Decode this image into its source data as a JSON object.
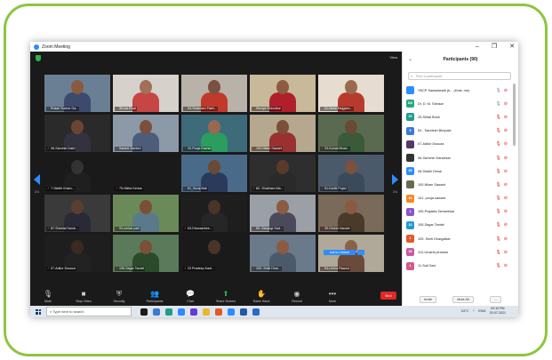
{
  "window": {
    "title": "Zoom Meeting",
    "minimize": "–",
    "maximize": "❐",
    "close": "✕"
  },
  "meeting": {
    "view_label": "View",
    "page_left": "2/4",
    "page_right": "2/4",
    "join_button": "Ask to Unmute",
    "tiles": [
      {
        "name": "Rukari Tushar Ga...",
        "bg": "#6b7f94",
        "skin": "#8a5a3c",
        "shirt": "#3c4a6e"
      },
      {
        "name": "35-Isa Pisal",
        "bg": "#d6d1cb",
        "skin": "#a0705a",
        "shirt": "#c64545"
      },
      {
        "name": "34-Shabnam Patel...",
        "bg": "#b8b2a8",
        "skin": "#7a5040",
        "shirt": "#c0392b"
      },
      {
        "name": "Shreya Shirodkar",
        "bg": "#c8b99a",
        "skin": "#8d5a42",
        "shirt": "#b0202a"
      },
      {
        "name": "31-Neha Majgaon...",
        "bg": "#e6ddd0",
        "skin": "#9a6a4e",
        "shirt": "#b83a2f"
      },
      {
        "name": "06-Sarvesh Dalvi",
        "bg": "#2a2a2a",
        "skin": "#6a4432",
        "shirt": "#33333f"
      },
      {
        "name": "Sanket Zambre",
        "bg": "#8c9aa8",
        "skin": "#7b503a",
        "shirt": "#4c5d7a"
      },
      {
        "name": "20-Pooja Kashid",
        "bg": "#3d6b7a",
        "skin": "#9a6850",
        "shirt": "#2a9d5f"
      },
      {
        "name": "100-Nilam Sawant",
        "bg": "#b5a88f",
        "skin": "#7a5038",
        "shirt": "#9a3030"
      },
      {
        "name": "33-Komal Mhad...",
        "bg": "#5a6a50",
        "skin": "#6a4a34",
        "shirt": "#3a5a3a"
      },
      {
        "name": "7-Siddhi Kham...",
        "bg": "#1a1a1a",
        "skin": "#333333",
        "shirt": "#1f1f1f"
      },
      {
        "name": "75-Nikita Kerkar",
        "bg": "#1a1a1a",
        "skin": "#1a1a1a",
        "shirt": "#1a1a1a"
      },
      {
        "name": "61_Suraj Mali",
        "bg": "#4a6a8a",
        "skin": "#6a4a34",
        "shirt": "#2a3a5a"
      },
      {
        "name": "82- Shubham Ma...",
        "bg": "#2e2e2e",
        "skin": "#5a3a2a",
        "shirt": "#2a2a2a"
      },
      {
        "name": "51-Kartik Pujari",
        "bg": "#4a5a6a",
        "skin": "#7a5040",
        "shirt": "#3a4a5a"
      },
      {
        "name": "87-Sheetal Samir...",
        "bg": "#3a3a3a",
        "skin": "#5a3e30",
        "shirt": "#2a2a36"
      },
      {
        "name": "93-omkar patil",
        "bg": "#6a8a5a",
        "skin": "#7b4e38",
        "shirt": "#5a7a8a"
      },
      {
        "name": "63-Dhanashree...",
        "bg": "#1e1e1e",
        "skin": "#4a3428",
        "shirt": "#262626"
      },
      {
        "name": "59 -Sanyogi Gad...",
        "bg": "#9aa0a6",
        "skin": "#8a5c44",
        "shirt": "#4a4a5a"
      },
      {
        "name": "39-Omkar Nandre",
        "bg": "#7a6a5a",
        "skin": "#8a5a40",
        "shirt": "#4a3a2a"
      },
      {
        "name": "07-Aditor Dsouza",
        "bg": "#1e1e1e",
        "skin": "#3a2a20",
        "shirt": "#222222"
      },
      {
        "name": "106-Sagar Tandel",
        "bg": "#5a7a5a",
        "skin": "#7a5038",
        "shirt": "#2a4a2a"
      },
      {
        "name": "23 Pradeep Kant...",
        "bg": "#1a1a1a",
        "skin": "#4a3428",
        "shirt": "#1a1a1a"
      },
      {
        "name": "109- Smiti Dhar...",
        "bg": "#6a7a8a",
        "skin": "#8a5a44",
        "shirt": "#4a5a6a"
      },
      {
        "name": "94-Leena Rawool",
        "bg": "#b0a898",
        "skin": "#8a6048",
        "shirt": "#6a4a3a"
      }
    ]
  },
  "toolbar": {
    "buttons": [
      {
        "label": "Mute",
        "icon": "🎙"
      },
      {
        "label": "Stop Video",
        "icon": "■"
      },
      {
        "label": "Security",
        "icon": "⛨"
      },
      {
        "label": "Participants",
        "icon": "👥"
      },
      {
        "label": "Chat",
        "icon": "💬"
      },
      {
        "label": "Share Screen",
        "icon": "⬆"
      },
      {
        "label": "Raise Hand",
        "icon": "✋"
      },
      {
        "label": "Record",
        "icon": "◉"
      },
      {
        "label": "More",
        "icon": "•••"
      }
    ],
    "participants_count": "90",
    "end_label": "End"
  },
  "participants": {
    "title": "Participants (90)",
    "search_placeholder": "Find a participant",
    "list": [
      {
        "name": "YBCP Sawantwadi (b... (Host, me)",
        "initials": "",
        "color": "#2d8cff",
        "mic_on": true
      },
      {
        "name": "Dr. D. M. Shinkar",
        "initials": "DD",
        "color": "#28a87a",
        "mic_on": true
      },
      {
        "name": "25-Shital Bhoir",
        "initials": "25",
        "color": "#1f9c8c",
        "mic_on": false
      },
      {
        "name": "54 - Sandesh Bhopale",
        "initials": "5",
        "color": "#3a7bd5",
        "mic_on": false
      },
      {
        "name": "07-Aditor Dsouza",
        "initials": "",
        "color": "#553a6a",
        "mic_on": false
      },
      {
        "name": "06-Sarvesh Dandekar",
        "initials": "",
        "color": "#333333",
        "mic_on": false
      },
      {
        "name": "08-Siddhi Desai",
        "initials": "08",
        "color": "#2d8cff",
        "mic_on": false
      },
      {
        "name": "100-Nilam Sawant",
        "initials": "",
        "color": "#6a6a50",
        "mic_on": false
      },
      {
        "name": "101- pooja sawant",
        "initials": "10",
        "color": "#f08a24",
        "mic_on": false
      },
      {
        "name": "105-Prajakta Tamanekar",
        "initials": "1",
        "color": "#8a56c8",
        "mic_on": false
      },
      {
        "name": "106-Sagar Tandel",
        "initials": "10",
        "color": "#1f9cc8",
        "mic_on": false
      },
      {
        "name": "109- Smiti Dhargalkar",
        "initials": "1",
        "color": "#e05a2a",
        "mic_on": false
      },
      {
        "name": "112-Urushti pirankar",
        "initials": "1S",
        "color": "#c85aa0",
        "mic_on": false
      },
      {
        "name": "11-Sail Gad",
        "initials": "1",
        "color": "#d05a8a",
        "mic_on": false
      }
    ],
    "invite_label": "Invite",
    "mute_all_label": "Mute All",
    "more_label": "..."
  },
  "taskbar": {
    "search_placeholder": "Type here to search",
    "temperature": "24°C",
    "language": "ENG",
    "time": "03:10 PM",
    "date": "20-07-2021",
    "app_colors": [
      "#1a1a1a",
      "#3a7bd5",
      "#1f9c8c",
      "#2d8cff",
      "#6a3ad5",
      "#e8b82a",
      "#e05a2a",
      "#2d8cff",
      "#1f5aa8",
      "#2a6ac8"
    ]
  }
}
